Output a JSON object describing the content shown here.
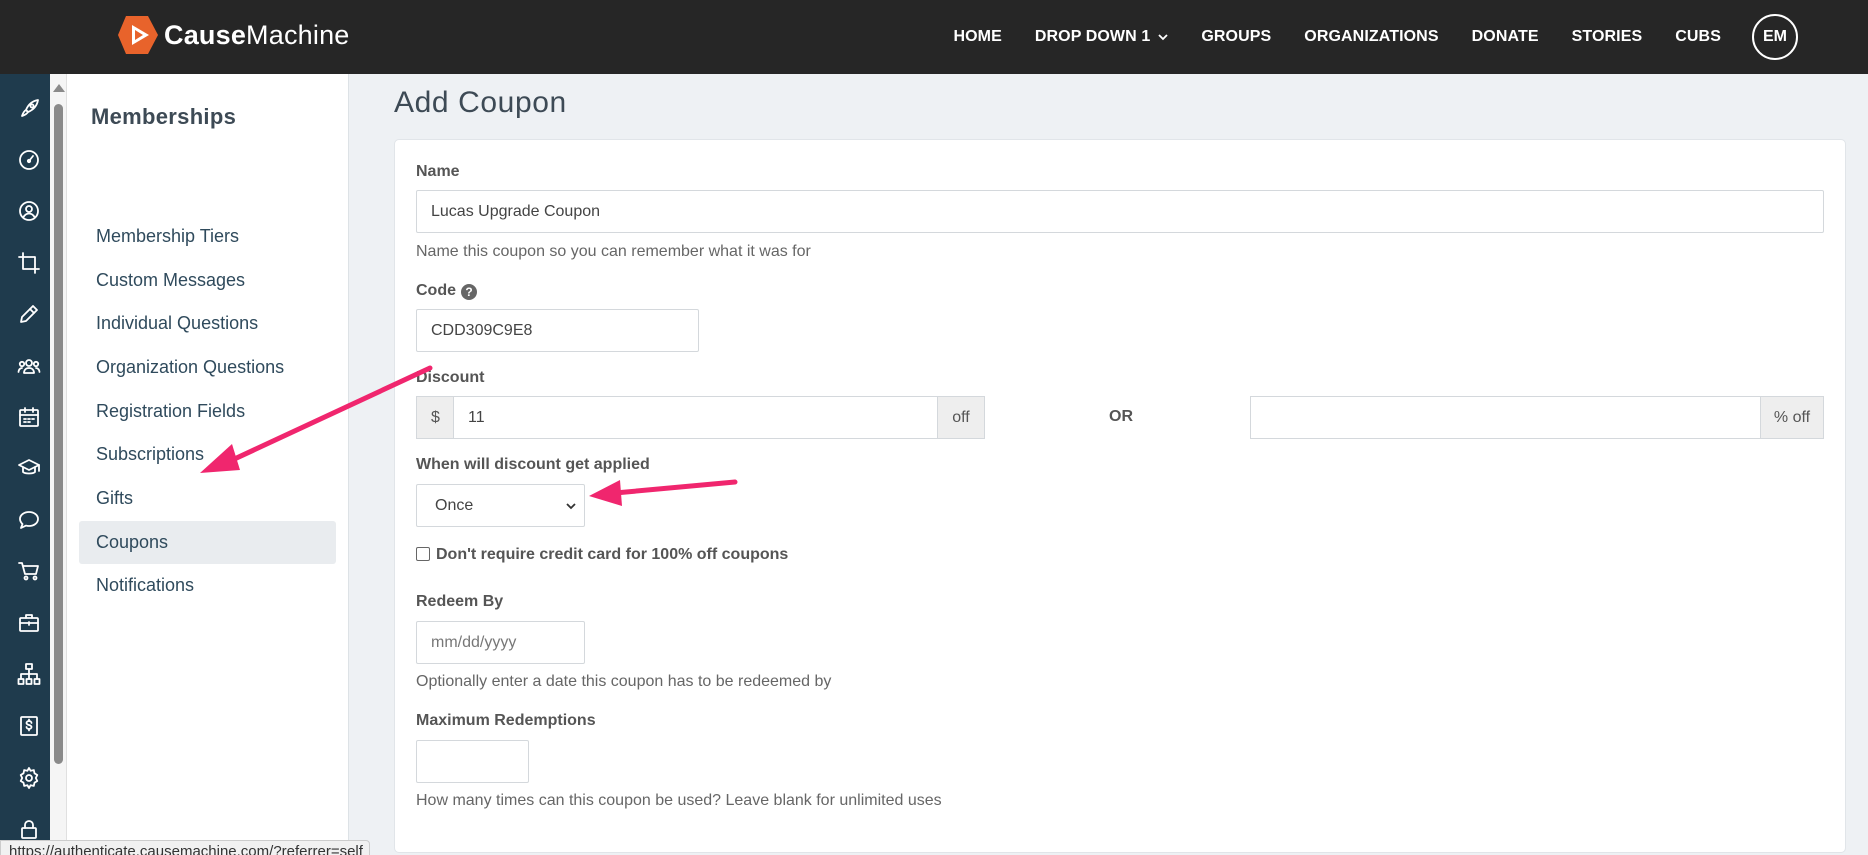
{
  "brand": {
    "name_bold": "Cause",
    "name_rest": "Machine",
    "accent": "#e8632b"
  },
  "nav": {
    "items": [
      "HOME",
      "DROP DOWN 1",
      "GROUPS",
      "ORGANIZATIONS",
      "DONATE",
      "STORIES",
      "CUBS"
    ],
    "avatar": "EM"
  },
  "rail": {
    "icons": [
      "rocket-icon",
      "dashboard-icon",
      "user-circle-icon",
      "crop-icon",
      "pencil-icon",
      "users-icon",
      "calendar-icon",
      "graduation-cap-icon",
      "chat-icon",
      "cart-icon",
      "briefcase-icon",
      "sitemap-icon",
      "dollar-icon",
      "gear-icon",
      "lock-icon"
    ]
  },
  "sidebar": {
    "title": "Memberships",
    "items": [
      {
        "label": "Membership Tiers"
      },
      {
        "label": "Custom Messages"
      },
      {
        "label": "Individual Questions"
      },
      {
        "label": "Organization Questions"
      },
      {
        "label": "Registration Fields"
      },
      {
        "label": "Subscriptions"
      },
      {
        "label": "Gifts"
      },
      {
        "label": "Coupons",
        "active": true
      },
      {
        "label": "Notifications"
      }
    ]
  },
  "page": {
    "title": "Add Coupon"
  },
  "form": {
    "name": {
      "label": "Name",
      "value": "Lucas Upgrade Coupon",
      "help": "Name this coupon so you can remember what it was for"
    },
    "code": {
      "label": "Code",
      "value": "CDD309C9E8"
    },
    "discount": {
      "label": "Discount",
      "prefix": "$",
      "amount": "11",
      "amount_suffix": "off",
      "or": "OR",
      "percent": "",
      "percent_suffix": "% off"
    },
    "apply": {
      "label": "When will discount get applied",
      "selected": "Once"
    },
    "no_cc": {
      "label": "Don't require credit card for 100% off coupons",
      "checked": false
    },
    "redeem_by": {
      "label": "Redeem By",
      "placeholder": "mm/dd/yyyy",
      "help": "Optionally enter a date this coupon has to be redeemed by"
    },
    "max_redemptions": {
      "label": "Maximum Redemptions",
      "value": "",
      "help": "How many times can this coupon be used? Leave blank for unlimited uses"
    }
  },
  "status_url": "https://authenticate.causemachine.com/?referrer=self",
  "colors": {
    "topbar": "#262626",
    "rail": "#1f3b4d",
    "arrow": "#f0266e"
  }
}
